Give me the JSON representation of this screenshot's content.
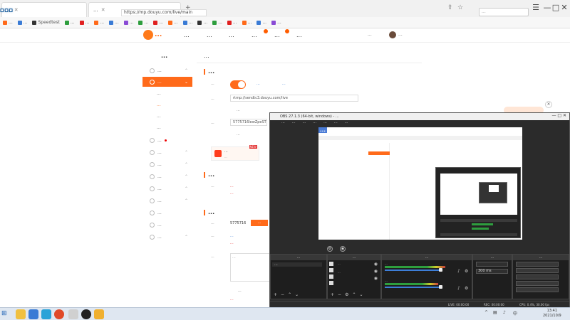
{
  "caption": "...",
  "browser": {
    "tabs": [
      {
        "title": "...",
        "color": "#4a90e2"
      },
      {
        "title": "...",
        "color": "#ff6a1a"
      }
    ],
    "url": "https://mp.douyu.com/live/main",
    "search_placeholder": "...",
    "bookmarks": [
      {
        "label": "...",
        "color": "#ff6a1a"
      },
      {
        "label": "...",
        "color": "#3a7bd5"
      },
      {
        "label": "Speedtest",
        "color": "#333333"
      },
      {
        "label": "...",
        "color": "#2e9e3e"
      },
      {
        "label": "...",
        "color": "#e02020"
      },
      {
        "label": "...",
        "color": "#ff6a1a"
      },
      {
        "label": "...",
        "color": "#3a7bd5"
      },
      {
        "label": "...",
        "color": "#8a4bd5"
      },
      {
        "label": "...",
        "color": "#2e9e3e"
      },
      {
        "label": "...",
        "color": "#e02020"
      },
      {
        "label": "...",
        "color": "#ff6a1a"
      },
      {
        "label": "...",
        "color": "#3a7bd5"
      },
      {
        "label": "...",
        "color": "#333333"
      },
      {
        "label": "...",
        "color": "#2e9e3e"
      },
      {
        "label": "...",
        "color": "#e02020"
      },
      {
        "label": "...",
        "color": "#ff6a1a"
      },
      {
        "label": "...",
        "color": "#3a7bd5"
      },
      {
        "label": "...",
        "color": "#8a4bd5"
      }
    ]
  },
  "site": {
    "logo_text": "...",
    "nav": [
      "...",
      "...",
      "...",
      "...",
      "...",
      "..."
    ],
    "header_right": [
      "...",
      "..."
    ]
  },
  "sidebar": {
    "title": "...",
    "items": [
      {
        "label": "...",
        "active": false
      },
      {
        "label": "...",
        "active": true
      }
    ],
    "sub_items": [
      "...",
      "...",
      "...",
      "..."
    ],
    "more_items": [
      "...",
      "...",
      "...",
      "...",
      "...",
      "...",
      "...",
      "...",
      "..."
    ]
  },
  "main": {
    "title": "...",
    "section_push": "...",
    "toggle_label": "...",
    "link_one": "...",
    "link_two": "...",
    "rtmp_label": "...",
    "rtmp_value": "rtmp://sendtc3.douyu.com/live",
    "copy_label": "...",
    "key_label": "...",
    "key_value": "5775716lewZpeSTWF",
    "banner_title": "...",
    "banner_sub": "...",
    "banner_new": "NEW",
    "section_notice": "...",
    "notice_label": "...",
    "notice_red_one": "...",
    "notice_red_two": "...",
    "section_room": "...",
    "room_id_label": "...",
    "room_id_value": "5775716",
    "room_btn": "...",
    "room_title_label": "...",
    "room_title_value": "...",
    "room_title_red": "...",
    "announce_label": "...",
    "announce_value": "...",
    "modify_label": "...",
    "footer_red": "..."
  },
  "obs": {
    "title": "OBS 27.1.3 (64-bit, windows) - ...",
    "menu": [
      "...",
      "...",
      "...",
      "...",
      "...",
      "...",
      "..."
    ],
    "preview_caption": "...",
    "docks": [
      {
        "title": "..."
      },
      {
        "title": "..."
      },
      {
        "title": "..."
      },
      {
        "title": "..."
      },
      {
        "title": "..."
      }
    ],
    "scene_item": "...",
    "source_items": [
      "...",
      "..."
    ],
    "mixer_labels": [
      "...",
      "..."
    ],
    "transition_field": "300 ms",
    "status": {
      "live": "LIVE: 00:00:00",
      "rec": "REC: 00:00:00",
      "cpu": "CPU: 0.4%, 30.00 fps"
    }
  },
  "taskbar": {
    "time": "13:41",
    "date": "2021/10/9"
  },
  "colors": {
    "accent": "#ff6a1a",
    "link": "#3a7bd5",
    "error": "#e02020"
  }
}
